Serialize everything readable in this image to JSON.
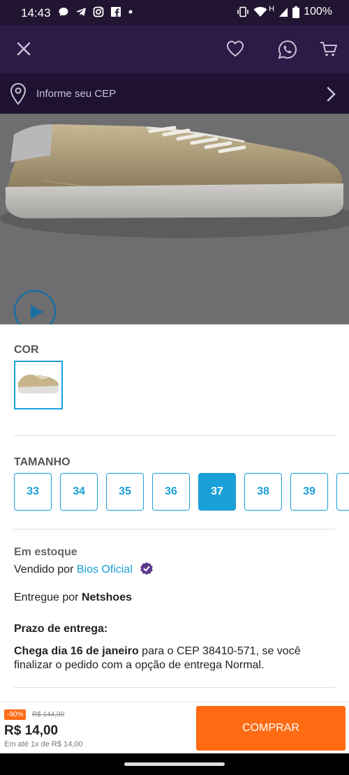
{
  "status_bar": {
    "time": "14:43",
    "battery": "100%",
    "network": "H",
    "left_icons": [
      "message-icon",
      "telegram-icon",
      "instagram-icon",
      "facebook-icon",
      "dot-icon"
    ],
    "right_icons": [
      "vibrate-icon",
      "wifi-icon",
      "signal-icon",
      "battery-icon"
    ]
  },
  "app_bar": {
    "icons": [
      "close-icon",
      "heart-icon",
      "whatsapp-icon",
      "cart-icon"
    ]
  },
  "cep_bar": {
    "label": "Informe seu CEP"
  },
  "hero": {
    "play_icon": "play-icon"
  },
  "color_section": {
    "label": "COR"
  },
  "size_section": {
    "label": "TAMANHO",
    "sizes": [
      "33",
      "34",
      "35",
      "36",
      "37",
      "38",
      "39"
    ],
    "selected": "37"
  },
  "stock": {
    "status": "Em estoque",
    "sold_by_prefix": "Vendido por",
    "seller": "Bios Oficial",
    "delivered_by_prefix": "Entregue por",
    "carrier": "Netshoes"
  },
  "delivery": {
    "title": "Prazo de entrega:",
    "bold_part": "Chega dia 16 de janeiro",
    "rest": " para o CEP 38410-571, se você finalizar o pedido com a opção de entrega Normal."
  },
  "bottom_bar": {
    "discount": "-90%",
    "old_price": "R$ 144,00",
    "price": "R$ 14,00",
    "installments": "Em até 1x de R$ 14,00",
    "buy_label": "COMPRAR"
  },
  "colors": {
    "accent": "#1aa0d8",
    "brand_dark": "#2e1a47",
    "buy": "#ff6a13"
  }
}
